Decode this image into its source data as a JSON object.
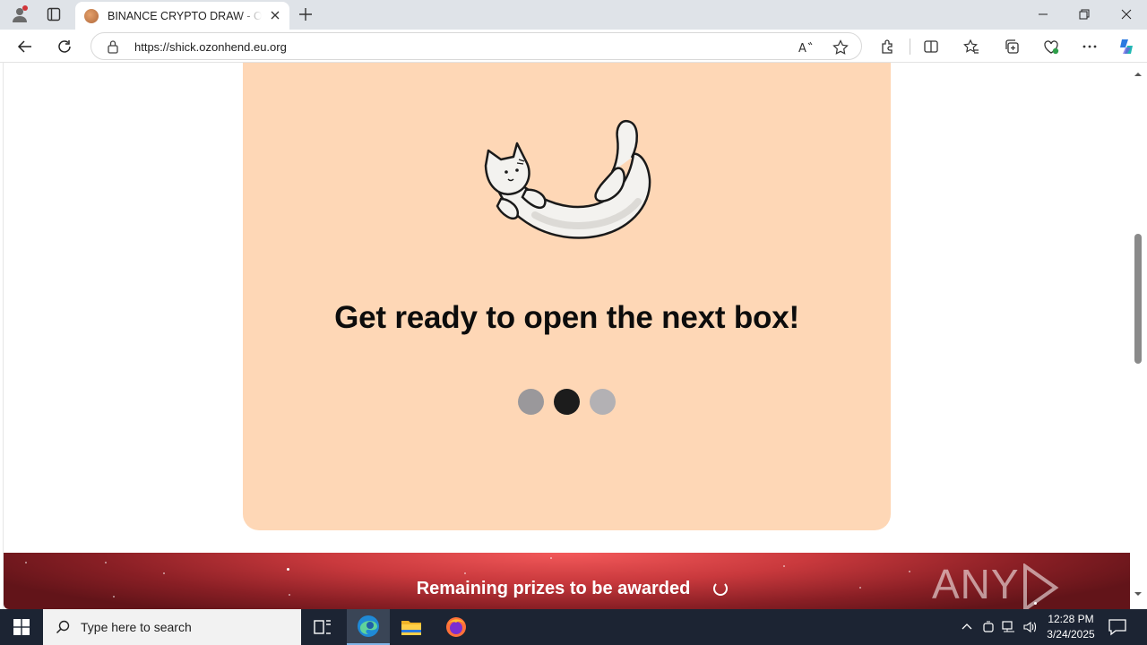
{
  "browser": {
    "tab_title": "BINANCE CRYPTO DRAW - Official",
    "url": "https://shick.ozonhend.eu.org"
  },
  "page": {
    "headline": "Get ready to open the next box!",
    "loading_dots_colors": [
      "#9a989b",
      "#1c1c1c",
      "#b3b1b4"
    ],
    "card_color": "#fed7b6",
    "banner_text": "Remaining prizes to be awarded",
    "watermark": "ANY RUN"
  },
  "taskbar": {
    "search_placeholder": "Type here to search",
    "time": "12:28 PM",
    "date": "3/24/2025"
  },
  "icons": [
    "profile-icon",
    "workspaces-icon",
    "close-icon",
    "plus-icon",
    "minimize-icon",
    "restore-icon",
    "back-icon",
    "refresh-icon",
    "lock-icon",
    "read-aloud-icon",
    "favorite-star-icon",
    "extensions-icon",
    "split-screen-icon",
    "favorites-icon",
    "collections-icon",
    "browser-essentials-icon",
    "more-icon",
    "copilot-icon",
    "windows-start-icon",
    "search-icon",
    "task-view-icon",
    "edge-icon",
    "file-explorer-icon",
    "firefox-icon",
    "chevron-up-icon",
    "network-icon",
    "volume-icon",
    "notification-icon"
  ]
}
